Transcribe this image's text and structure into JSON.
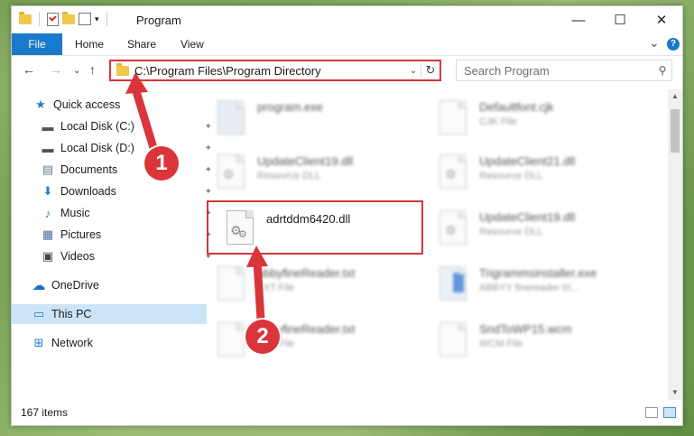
{
  "window": {
    "title": "Program"
  },
  "winbtns": {
    "minimize": "—",
    "maximize": "☐",
    "close": "✕"
  },
  "ribbon": {
    "tabs": [
      "File",
      "Home",
      "Share",
      "View"
    ],
    "expand": "⌄",
    "help": "?"
  },
  "nav": {
    "back": "←",
    "forward": "→",
    "recent": "⌄",
    "up": "↑"
  },
  "address": {
    "path": "C:\\Program Files\\Program Directory",
    "dropdown": "⌄",
    "refresh": "↻"
  },
  "search": {
    "placeholder": "Search Program",
    "icon": "⚲"
  },
  "sidebar": {
    "items": [
      {
        "label": "Quick access",
        "icon": "★"
      },
      {
        "label": "Local Disk (C:)",
        "icon": "▬",
        "pinned": "✦"
      },
      {
        "label": "Local Disk (D:)",
        "icon": "▬",
        "pinned": "✦"
      },
      {
        "label": "Documents",
        "icon": "▤",
        "pinned": "✦"
      },
      {
        "label": "Downloads",
        "icon": "⬇",
        "pinned": "✦"
      },
      {
        "label": "Music",
        "icon": "♪",
        "pinned": "✦"
      },
      {
        "label": "Pictures",
        "icon": "▦",
        "pinned": "✦"
      },
      {
        "label": "Videos",
        "icon": "▣",
        "pinned": "✦"
      },
      {
        "label": "OneDrive",
        "icon": "☁"
      },
      {
        "label": "This PC",
        "icon": "▭"
      },
      {
        "label": "Network",
        "icon": "⊞"
      }
    ]
  },
  "files": [
    {
      "name": "program.exe",
      "type": ""
    },
    {
      "name": "Defaultfont.cjk",
      "type": "CJK File"
    },
    {
      "name": "UpdateClient19.dll",
      "type": "Resource DLL"
    },
    {
      "name": "UpdateClient21.dll",
      "type": "Resource DLL"
    },
    {
      "name": "adrtddm6420.dll",
      "type": ""
    },
    {
      "name": "UpdateClient19.dll",
      "type": "Resource DLL"
    },
    {
      "name": "abbyfineReader.txt",
      "type": "TXT File"
    },
    {
      "name": "Trigrammsinstaller.exe",
      "type": "ABBYY finereader tri..."
    },
    {
      "name": "abbyfineReader.txt",
      "type": "TXT File"
    },
    {
      "name": "SndToWP15.wcm",
      "type": "WCM File"
    }
  ],
  "status": {
    "count": "167 items"
  },
  "scroll": {
    "up": "▲",
    "down": "▼"
  },
  "annotations": {
    "step1": "1",
    "step2": "2"
  },
  "colors": {
    "accent": "#1979ca",
    "highlight": "#d9353b"
  }
}
